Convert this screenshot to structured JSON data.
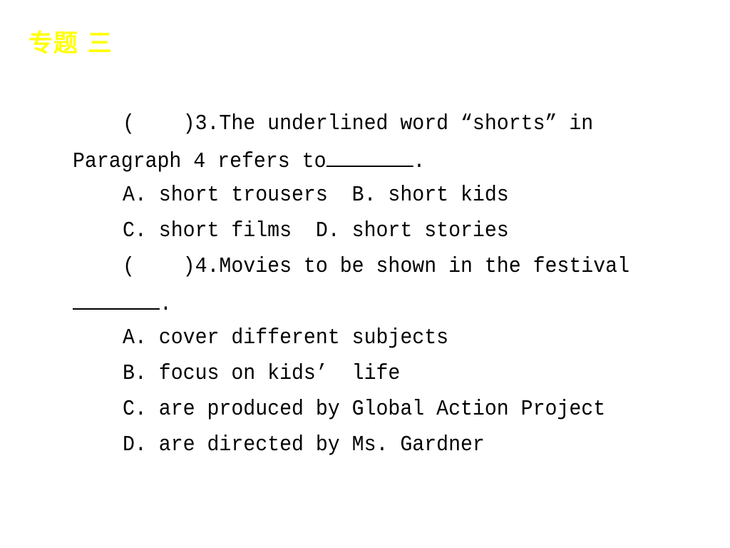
{
  "header": {
    "title": "专题 三"
  },
  "questions": [
    {
      "stem_line1": "(    )3.The underlined word “shorts” in",
      "stem_line2_before": "Paragraph 4 refers to",
      "stem_end": ".",
      "options": [
        "A. short trousers  B. short kids",
        "C. short films  D. short stories"
      ]
    },
    {
      "stem_line1": "(    )4.Movies to be shown in the festival",
      "stem_end": ".",
      "options": [
        "A. cover different subjects",
        "B. focus on kids’  life",
        "C. are produced by Global Action Project",
        "D. are directed by Ms. Gardner"
      ]
    }
  ]
}
